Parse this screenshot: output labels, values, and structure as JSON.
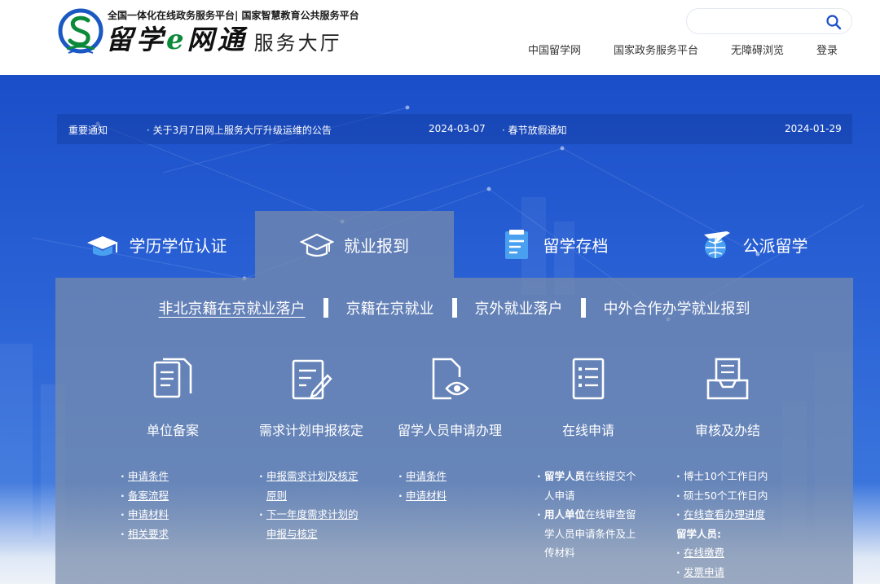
{
  "header": {
    "subtitle": "全国一体化在线政务服务平台| 国家智慧教育公共服务平台",
    "brand_prefix": "留学",
    "brand_e": "e",
    "brand_suffix": "网通",
    "brand_hall": "服务大厅",
    "search_placeholder": "",
    "nav": [
      "中国留学网",
      "国家政务服务平台",
      "无障碍浏览",
      "登录"
    ]
  },
  "notice": {
    "label": "重要通知",
    "items": [
      {
        "title": "关于3月7日网上服务大厅升级运维的公告",
        "date": "2024-03-07"
      },
      {
        "title": "春节放假通知",
        "date": "2024-01-29"
      }
    ]
  },
  "tabs": [
    "学历学位认证",
    "就业报到",
    "留学存档",
    "公派留学"
  ],
  "subtabs": [
    "非北京籍在京就业落户",
    "京籍在京就业",
    "京外就业落户",
    "中外合作办学就业报到"
  ],
  "columns": [
    {
      "title": "单位备案",
      "icon": "documents-icon"
    },
    {
      "title": "需求计划申报核定",
      "icon": "edit-form-icon"
    },
    {
      "title": "留学人员申请办理",
      "icon": "file-view-icon"
    },
    {
      "title": "在线申请",
      "icon": "checklist-icon"
    },
    {
      "title": "审核及办结",
      "icon": "inbox-icon"
    }
  ],
  "links": {
    "col1": [
      "申请条件",
      "备案流程",
      "申请材料",
      "相关要求"
    ],
    "col2": [
      "申报需求计划及核定",
      "原则",
      "下一年度需求计划的",
      "申报与核定"
    ],
    "col3": [
      "申请条件",
      "申请材料"
    ],
    "col4": {
      "a_bold": "留学人员",
      "a_rest": "在线提交个",
      "a_line2": "人申请",
      "b_bold": "用人单位",
      "b_rest": "在线审查留",
      "b_line2": "学人员申请条件及上",
      "b_line3": "传材料"
    },
    "col5": {
      "l1": "博士10个工作日内",
      "l2": "硕士50个工作日内",
      "l3": "在线查看办理进度",
      "heading": "留学人员:",
      "l4": "在线缴费",
      "l5": "发票申请"
    }
  },
  "colors": {
    "brand_blue": "#1e56c8",
    "brand_green": "#0b8a3a",
    "panel": "#7a8caa"
  }
}
